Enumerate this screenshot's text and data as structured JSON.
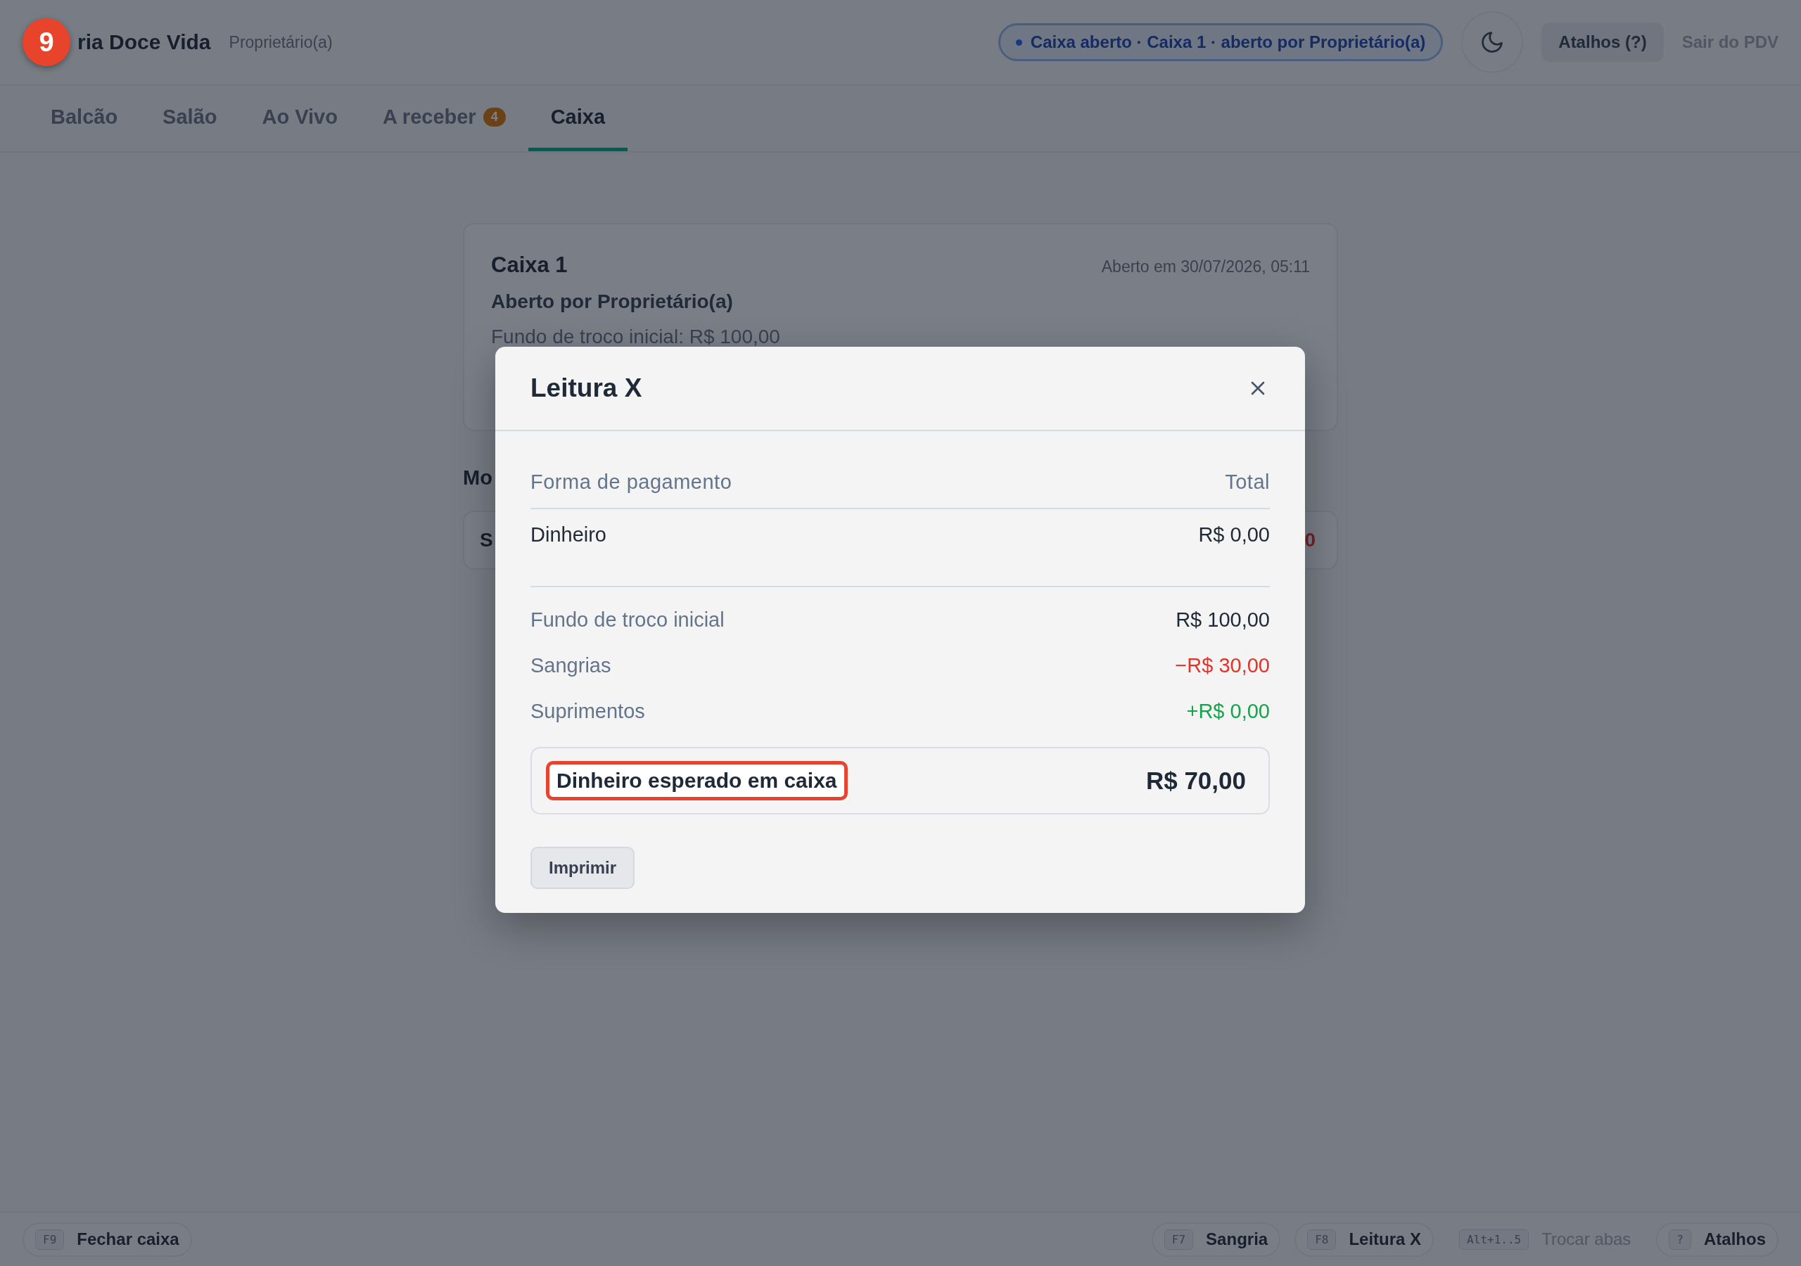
{
  "marker": "9",
  "header": {
    "brand": "ria Doce Vida",
    "role": "Proprietário(a)",
    "status": {
      "text": "Caixa aberto · Caixa 1 · aberto por Proprietário(a)"
    },
    "shortcuts_button": "Atalhos (?)",
    "exit_link": "Sair do PDV"
  },
  "tabs": [
    {
      "label": "Balcão",
      "selected": false
    },
    {
      "label": "Salão",
      "selected": false
    },
    {
      "label": "Ao Vivo",
      "selected": false
    },
    {
      "label": "A receber",
      "badge": "4",
      "selected": false
    },
    {
      "label": "Caixa",
      "selected": true
    }
  ],
  "register_card": {
    "title": "Caixa 1",
    "opened_at": "Aberto em 30/07/2026, 05:11",
    "opened_by": "Aberto por Proprietário(a)",
    "opening_float": "Fundo de troco inicial: R$ 100,00"
  },
  "movements": {
    "heading": "Mo",
    "row": {
      "column_1": "S",
      "column_2": "0"
    }
  },
  "dialog": {
    "title": "Leitura X",
    "columns": [
      "Forma de pagamento",
      "Total"
    ],
    "payments": [
      {
        "method": "Dinheiro",
        "total": "R$ 0,00"
      }
    ],
    "summary": [
      {
        "label": "Fundo de troco inicial",
        "value": "R$ 100,00",
        "color": "#1f2937"
      },
      {
        "label": "Sangrias",
        "value": "−R$ 30,00",
        "color": "#e0342a"
      },
      {
        "label": "Suprimentos",
        "value": "+R$ 0,00",
        "color": "#16a34a"
      }
    ],
    "expected": {
      "label": "Dinheiro esperado em caixa",
      "value": "R$ 70,00",
      "highlighted": true
    },
    "print_button": "Imprimir"
  },
  "footer": {
    "left": [
      {
        "key": "F9",
        "label": "Fechar caixa",
        "kind": "chip"
      }
    ],
    "right": [
      {
        "key": "F7",
        "label": "Sangria",
        "kind": "chip"
      },
      {
        "key": "F8",
        "label": "Leitura X",
        "kind": "chip"
      },
      {
        "key": "Alt+1..5",
        "label": "Trocar abas",
        "kind": "plain"
      },
      {
        "key": "?",
        "label": "Atalhos",
        "kind": "chip"
      }
    ]
  }
}
